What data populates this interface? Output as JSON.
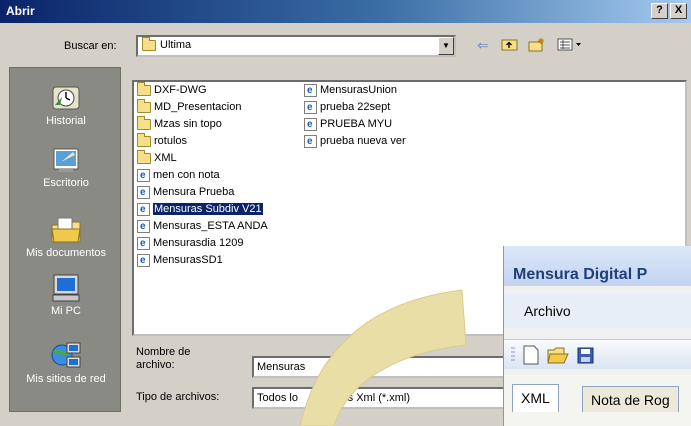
{
  "dialog": {
    "title": "Abrir",
    "help_glyph": "?",
    "close_glyph": "X"
  },
  "lookin": {
    "label": "Buscar en:",
    "value": "Ultima"
  },
  "places": [
    {
      "label": "Historial",
      "icon": "history-icon"
    },
    {
      "label": "Escritorio",
      "icon": "desktop-icon"
    },
    {
      "label": "Mis documentos",
      "icon": "my-documents-icon"
    },
    {
      "label": "Mi PC",
      "icon": "my-computer-icon"
    },
    {
      "label": "Mis sitios de red",
      "icon": "network-places-icon"
    }
  ],
  "files": {
    "col1": [
      {
        "name": "DXF-DWG",
        "type": "folder"
      },
      {
        "name": "MD_Presentacion",
        "type": "folder"
      },
      {
        "name": "Mzas sin topo",
        "type": "folder"
      },
      {
        "name": "rotulos",
        "type": "folder"
      },
      {
        "name": "XML",
        "type": "folder"
      },
      {
        "name": "men con nota",
        "type": "xml"
      },
      {
        "name": "Mensura Prueba",
        "type": "xml"
      },
      {
        "name": "Mensuras Subdiv V21",
        "type": "xml",
        "selected": true
      },
      {
        "name": "Mensuras_ESTA ANDA",
        "type": "xml"
      },
      {
        "name": "Mensurasdia 1209",
        "type": "xml"
      },
      {
        "name": "MensurasSD1",
        "type": "xml"
      }
    ],
    "col2": [
      {
        "name": "MensurasUnion",
        "type": "xml"
      },
      {
        "name": "prueba 22sept",
        "type": "xml"
      },
      {
        "name": "PRUEBA MYU",
        "type": "xml"
      },
      {
        "name": "prueba nueva ver",
        "type": "xml"
      }
    ]
  },
  "filename": {
    "label_line1": "Nombre de",
    "label_line2": "archivo:",
    "value": "Mensuras"
  },
  "filetype": {
    "label": "Tipo de archivos:",
    "value_a": "Todos lo",
    "value_b": "chivos Xml (*.xml)"
  },
  "overlay_window": {
    "title": "Mensura Digital P",
    "menu_archivo": "Archivo",
    "tabs": [
      "XML",
      "Nota de Rog"
    ]
  },
  "colors": {
    "title_bar_start": "#0a246a",
    "selection": "#0a246a",
    "swoosh": "#e9dea6"
  }
}
